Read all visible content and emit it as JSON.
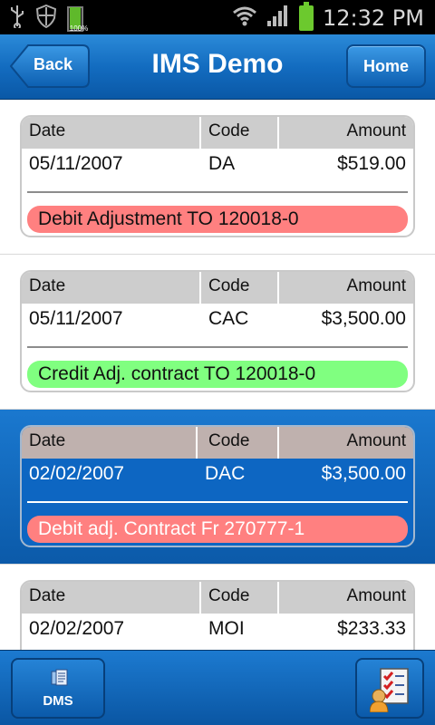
{
  "status_bar": {
    "time": "12:32 PM",
    "battery_small_label": "100%",
    "icons": [
      "usb-icon",
      "shield-icon",
      "battery-icon",
      "wifi-icon",
      "signal-icon",
      "battery-icon"
    ]
  },
  "header": {
    "title": "IMS Demo",
    "back_label": "Back",
    "home_label": "Home"
  },
  "columns": {
    "date": "Date",
    "code": "Code",
    "amount": "Amount"
  },
  "transactions": [
    {
      "date": "05/11/2007",
      "code": "DA",
      "amount": "$519.00",
      "description": "Debit Adjustment TO 120018-0",
      "color": "#ff8080",
      "selected": false
    },
    {
      "date": "05/11/2007",
      "code": "CAC",
      "amount": "$3,500.00",
      "description": "Credit Adj. contract TO 120018-0",
      "color": "#80ff80",
      "selected": false
    },
    {
      "date": "02/02/2007",
      "code": "DAC",
      "amount": "$3,500.00",
      "description": "Debit adj. Contract Fr 270777-1",
      "color": "#ff8080",
      "selected": true
    },
    {
      "date": "02/02/2007",
      "code": "MOI",
      "amount": "$233.33",
      "description": "",
      "color": "#ff8080",
      "selected": false
    }
  ],
  "footer": {
    "dms_label": "DMS",
    "right_button_icon": "contact-checklist-icon"
  },
  "colors": {
    "bar_blue": "#136cc0",
    "debit": "#ff8080",
    "credit": "#80ff80",
    "selected_row": "#0d66c2"
  }
}
